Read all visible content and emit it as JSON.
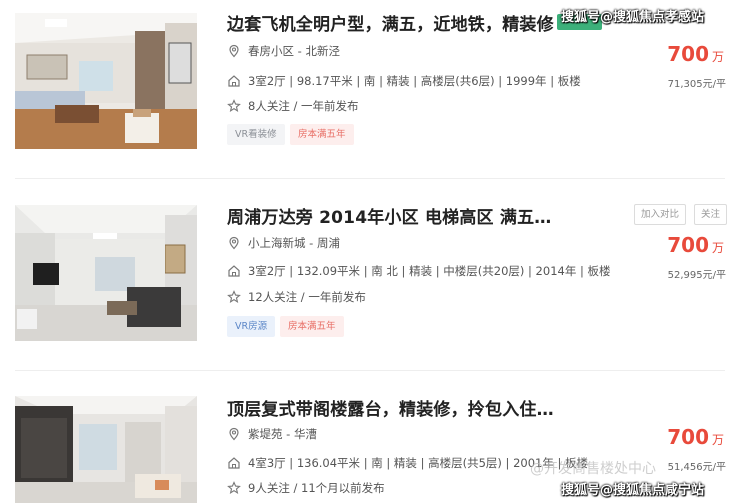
{
  "listings": [
    {
      "title": "边套飞机全明户型，满五，近地铁，精装修",
      "location": "春房小区 - 北新泾",
      "details": "3室2厅 | 98.17平米 | 南 | 精装 | 高楼层(共6层) | 1999年 | 板楼",
      "followers": "8人关注 / 一年前发布",
      "price": "700",
      "price_unit": "万",
      "unit_price": "71,305元/平",
      "tags": [
        "VR看装修",
        "房本满五年"
      ]
    },
    {
      "title": "周浦万达旁 2014年小区 电梯高区 满五…",
      "location": "小上海新城 - 周浦",
      "details": "3室2厅 | 132.09平米 | 南 北 | 精装 | 中楼层(共20层) | 2014年 | 板楼",
      "followers": "12人关注 / 一年前发布",
      "price": "700",
      "price_unit": "万",
      "unit_price": "52,995元/平",
      "tags": [
        "VR房源",
        "房本满五年"
      ],
      "compare_label": "加入对比",
      "follow_label": "关注"
    },
    {
      "title": "顶层复式带阁楼露台，精装修，拎包入住…",
      "location": "紫堤苑 - 华漕",
      "details": "4室3厅 | 136.04平米 | 南 | 精装 | 高楼层(共5层) | 2001年 | 板楼",
      "followers": "9人关注 / 11个月以前发布",
      "price": "700",
      "price_unit": "万",
      "unit_price": "51,456元/平"
    }
  ],
  "watermarks": {
    "top": "搜狐号@搜狐焦点孝感站",
    "bottom": "搜狐号@搜狐焦点咸宁站",
    "faint": "@开发商售楼处中心"
  },
  "colors": {
    "price": "#e84a3b",
    "badge_green": "#3cb07a"
  },
  "icons": [
    "location-pin-icon",
    "home-icon",
    "star-icon"
  ]
}
